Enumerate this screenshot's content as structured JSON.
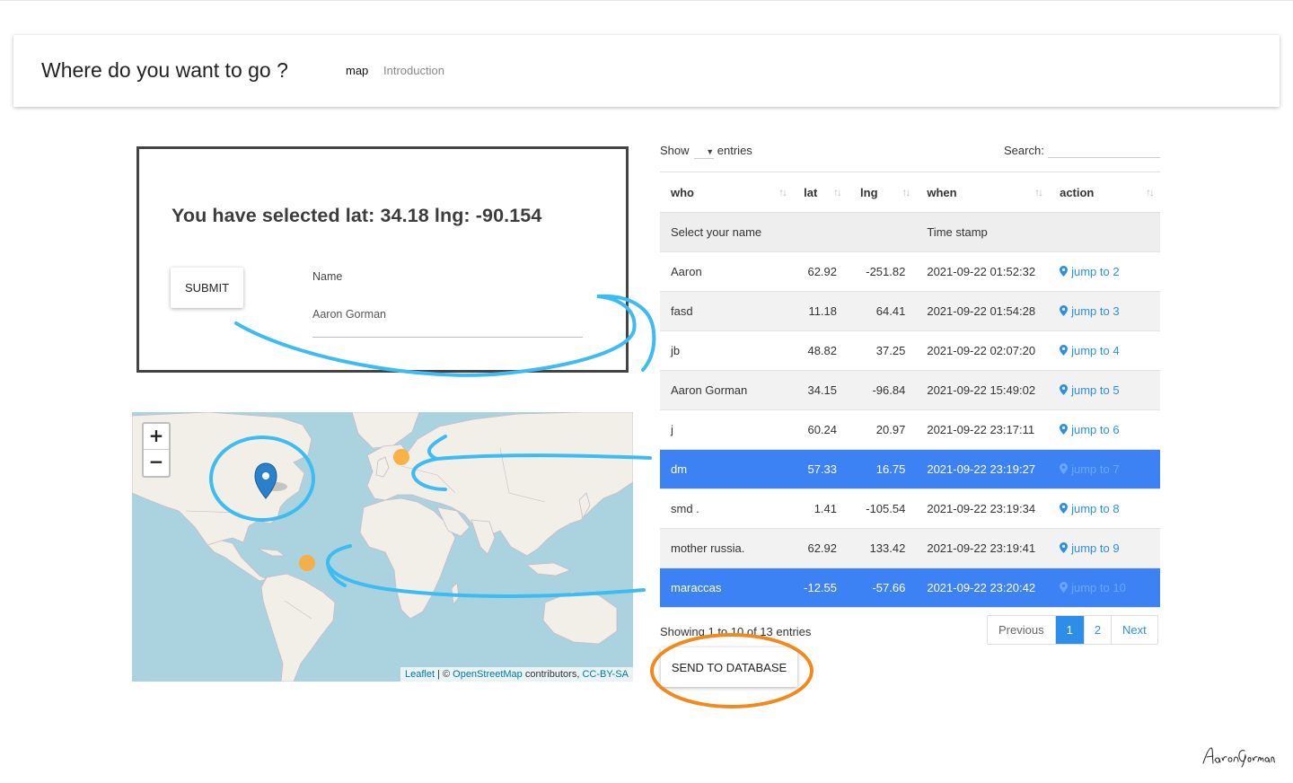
{
  "navbar": {
    "brand": "Where do you want to go ?",
    "links": [
      "map",
      "Introduction"
    ]
  },
  "selection": {
    "text": "You have selected lat: 34.18 lng: -90.154",
    "submit_label": "SUBMIT",
    "name_label": "Name",
    "name_value": "Aaron Gorman"
  },
  "map": {
    "zoom_in": "+",
    "zoom_out": "−",
    "attribution": {
      "leaflet": "Leaflet",
      "sep": " | © ",
      "osm": "OpenStreetMap",
      "contributors": " contributors, ",
      "license": "CC-BY-SA"
    },
    "marker_icon": "map-pin-icon",
    "circle_marker_color": "#f9ad3f"
  },
  "table": {
    "length_prefix": "Show",
    "length_suffix": "entries",
    "length_value": "",
    "search_label": "Search:",
    "search_value": "",
    "columns": [
      "who",
      "lat",
      "lng",
      "when",
      "action"
    ],
    "filters": {
      "who": "Select your name",
      "when": "Time stamp"
    },
    "rows": [
      {
        "who": "Aaron",
        "lat": "62.92",
        "lng": "-251.82",
        "when": "2021-09-22 01:52:32",
        "action": "jump to 2",
        "selected": false
      },
      {
        "who": "fasd",
        "lat": "11.18",
        "lng": "64.41",
        "when": "2021-09-22 01:54:28",
        "action": "jump to 3",
        "selected": false
      },
      {
        "who": "jb",
        "lat": "48.82",
        "lng": "37.25",
        "when": "2021-09-22 02:07:20",
        "action": "jump to 4",
        "selected": false
      },
      {
        "who": "Aaron Gorman",
        "lat": "34.15",
        "lng": "-96.84",
        "when": "2021-09-22 15:49:02",
        "action": "jump to 5",
        "selected": false
      },
      {
        "who": "j",
        "lat": "60.24",
        "lng": "20.97",
        "when": "2021-09-22 23:17:11",
        "action": "jump to 6",
        "selected": false
      },
      {
        "who": "dm",
        "lat": "57.33",
        "lng": "16.75",
        "when": "2021-09-22 23:19:27",
        "action": "jump to 7",
        "selected": true
      },
      {
        "who": "smd .",
        "lat": "1.41",
        "lng": "-105.54",
        "when": "2021-09-22 23:19:34",
        "action": "jump to 8",
        "selected": false
      },
      {
        "who": "mother russia.",
        "lat": "62.92",
        "lng": "133.42",
        "when": "2021-09-22 23:19:41",
        "action": "jump to 9",
        "selected": false
      },
      {
        "who": "maraccas",
        "lat": "-12.55",
        "lng": "-57.66",
        "when": "2021-09-22 23:20:42",
        "action": "jump to 10",
        "selected": true
      }
    ],
    "info": "Showing 1 to 10 of 13 entries",
    "pagination": {
      "previous": "Previous",
      "pages": [
        "1",
        "2"
      ],
      "active": "1",
      "next": "Next"
    },
    "action_icon": "map-pin-icon",
    "selected_row_color": "#3d82f5",
    "link_color": "#2d8ee8"
  },
  "send_button": "SEND TO DATABASE",
  "annotations": {
    "blue_color": "#3dbcf2",
    "orange_color": "#f08a1c"
  },
  "signature": "Aaron Gorman"
}
